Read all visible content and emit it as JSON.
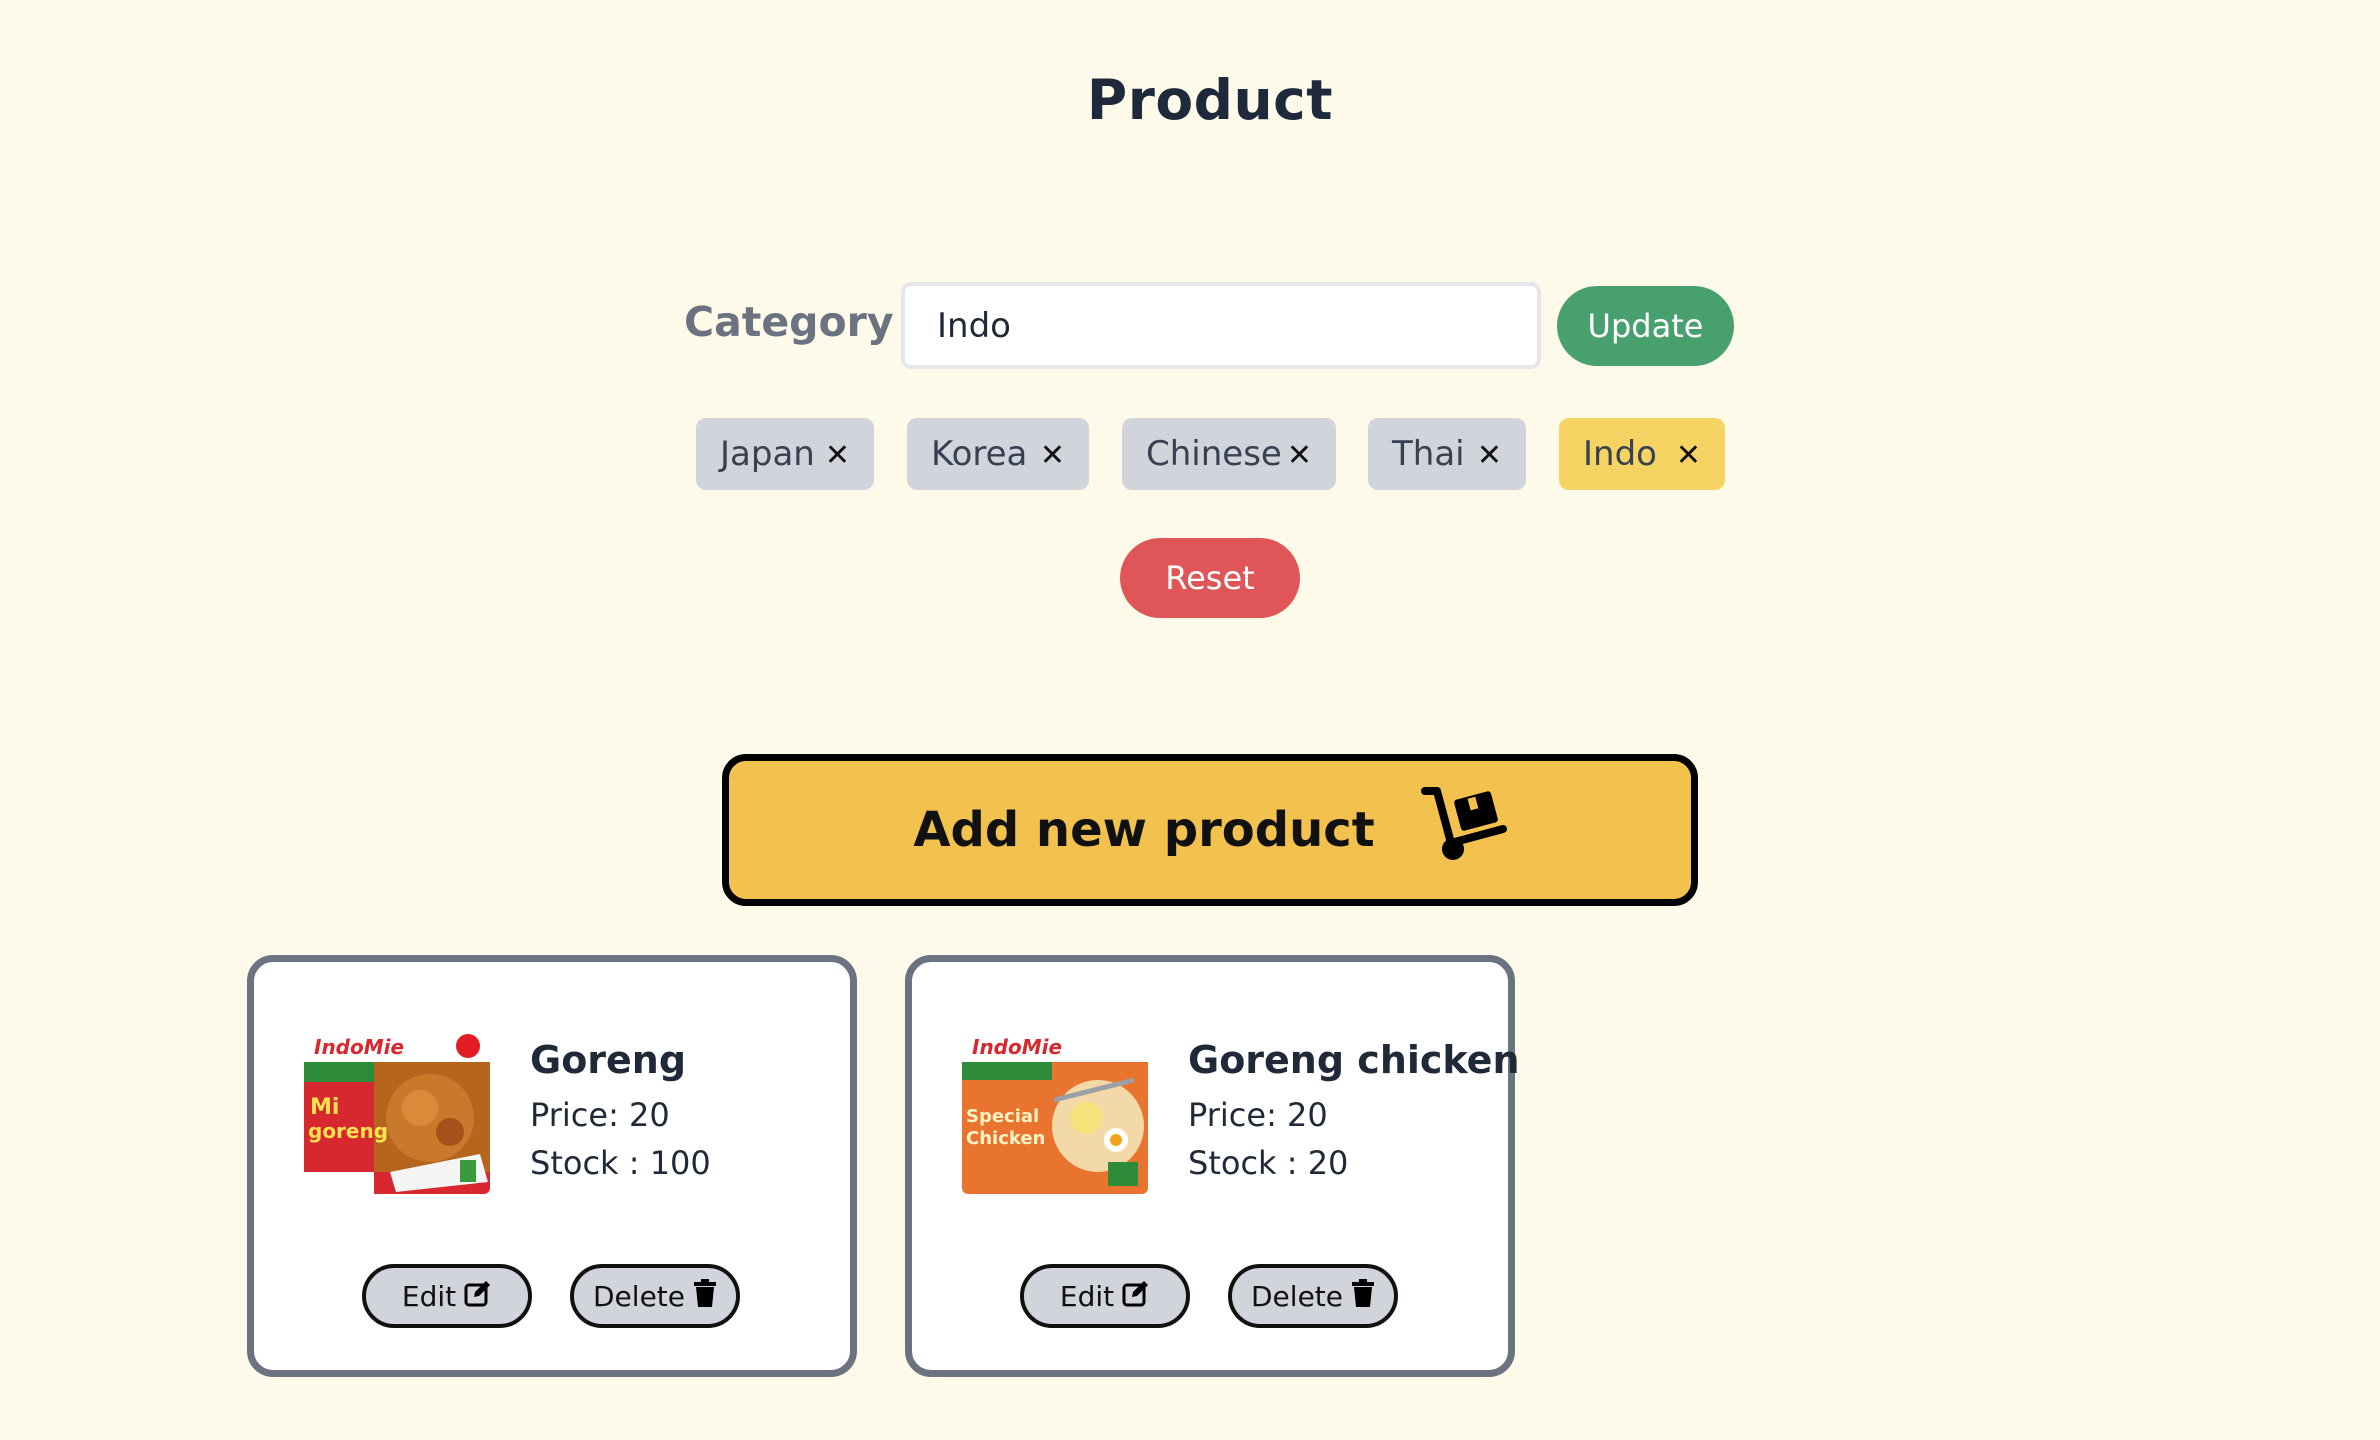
{
  "page": {
    "title": "Product"
  },
  "category": {
    "label": "Category :",
    "input_value": "Indo",
    "update_label": "Update"
  },
  "tags": [
    {
      "label": "Japan",
      "remove": "✕"
    },
    {
      "label": "Korea",
      "remove": "✕"
    },
    {
      "label": "Chinese",
      "remove": "✕"
    },
    {
      "label": "Thai",
      "remove": "✕"
    },
    {
      "label": "Indo",
      "remove": "✕"
    }
  ],
  "reset_label": "Reset",
  "add_product": {
    "label": "Add new product",
    "icon": "dolly-icon"
  },
  "products": [
    {
      "name": "Goreng",
      "price": "Price: 20",
      "stock": "Stock : 100",
      "image": "indomie-mi-goreng-package",
      "edit_label": "Edit",
      "delete_label": "Delete"
    },
    {
      "name": "Goreng chicken",
      "price": "Price: 20",
      "stock": "Stock : 20",
      "image": "indomie-special-chicken-package",
      "edit_label": "Edit",
      "delete_label": "Delete"
    }
  ],
  "colors": {
    "background": "#fefae9",
    "update": "#48a06f",
    "reset": "#e05658",
    "add_product": "#f2c14e",
    "tag": "#d1d5db",
    "tag_active": "#f5d464",
    "card_border": "#6b7280"
  }
}
